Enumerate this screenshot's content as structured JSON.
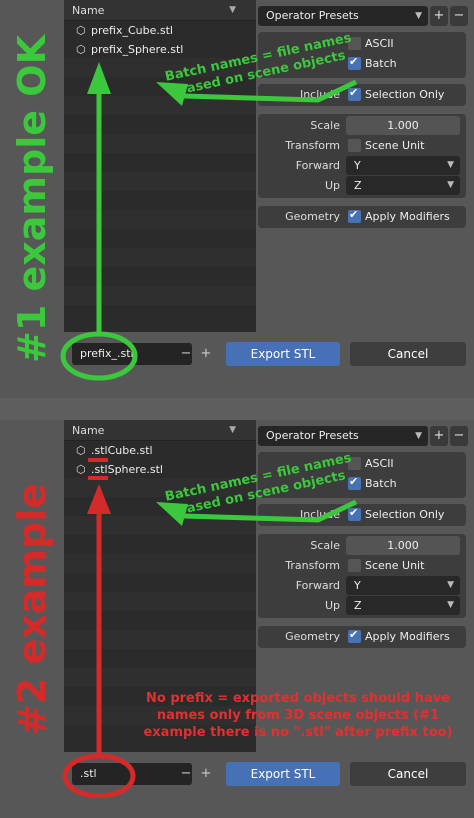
{
  "panel1": {
    "side_label": "#1 example OK",
    "header": "Name",
    "files": [
      "prefix_Cube.stl",
      "prefix_Sphere.stl"
    ],
    "filename": "prefix_.stl",
    "annotation": "Batch names = file names based on scene objects"
  },
  "panel2": {
    "side_label": "#2 example",
    "header": "Name",
    "files": [
      ".stlCube.stl",
      ".stlSphere.stl"
    ],
    "filename": ".stl",
    "annotation": "Batch names = file names based on scene objects",
    "note": "No prefix = exported objects should have names only from 3D scene objects (#1 example there is no \".stl\" after prefix too)"
  },
  "ui": {
    "operator_presets": "Operator Presets",
    "ascii": "ASCII",
    "batch": "Batch",
    "include_label": "Include",
    "selection_only": "Selection Only",
    "scale_label": "Scale",
    "scale_value": "1.000",
    "transform_label": "Transform",
    "scene_unit": "Scene Unit",
    "forward_label": "Forward",
    "forward_value": "Y",
    "up_label": "Up",
    "up_value": "Z",
    "geometry_label": "Geometry",
    "apply_modifiers": "Apply Modifiers",
    "export_button": "Export STL",
    "cancel_button": "Cancel",
    "plus": "+",
    "minus": "−",
    "close": "✕"
  },
  "colors": {
    "green": "#3cc83c",
    "red": "#d42a2a",
    "accent_blue": "#4771b7"
  }
}
